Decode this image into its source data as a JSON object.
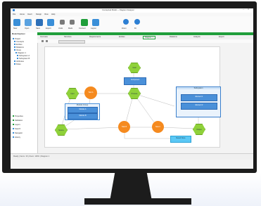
{
  "window": {
    "title": "Conceptual Model — Diagram Designer"
  },
  "menu": {
    "items": [
      "File",
      "Home",
      "Insert",
      "Design",
      "View",
      "Help"
    ]
  },
  "ribbon": {
    "buttons": [
      "New",
      "Open",
      "Save",
      "Export",
      "Undo",
      "Redo",
      "Connect",
      "Layout",
      "Zoom",
      "Fit",
      "Share",
      "Settings"
    ]
  },
  "left_pane": {
    "title": "Model Explorer",
    "items": [
      "Project",
      "Concepts",
      "Entities",
      "Relations",
      "Views",
      "Diagram 1",
      "Subsystem A",
      "Subsystem B",
      "Attributes",
      "Rules"
    ],
    "bottom_items": [
      "Properties",
      "Validation",
      "Layers",
      "Search",
      "Navigator",
      "History"
    ]
  },
  "tabs": [
    "Overview",
    "Structure",
    "Requirements",
    "Entities",
    "Diagram 1",
    "Relations",
    "Analysis",
    "Export"
  ],
  "diagram": {
    "nodes": {
      "hex_top": "Goal",
      "hex_mid": "Process",
      "hex_left": "Input",
      "hex_bottom_left": "Source",
      "hex_right": "Output",
      "circle_left": "Task A",
      "circle_mid": "Task B",
      "circle_right": "Task C",
      "box_top": "Component",
      "box_left_title": "Module Group",
      "box_left_a": "Module A",
      "box_left_b": "Module B",
      "box_right_title": "Subsystem",
      "box_right_a": "Element 1",
      "box_right_b": "Element 2",
      "box_bottom": "Result Store"
    }
  },
  "status": {
    "text": "Ready   |   Items: 16   |   Zoom: 100%   |   Diagram 1"
  },
  "colors": {
    "accent_green": "#1f9e3a",
    "node_green": "#8fd13a",
    "node_orange": "#f58a1f",
    "node_blue": "#4a90d9",
    "node_cyan": "#5bc8f5"
  }
}
